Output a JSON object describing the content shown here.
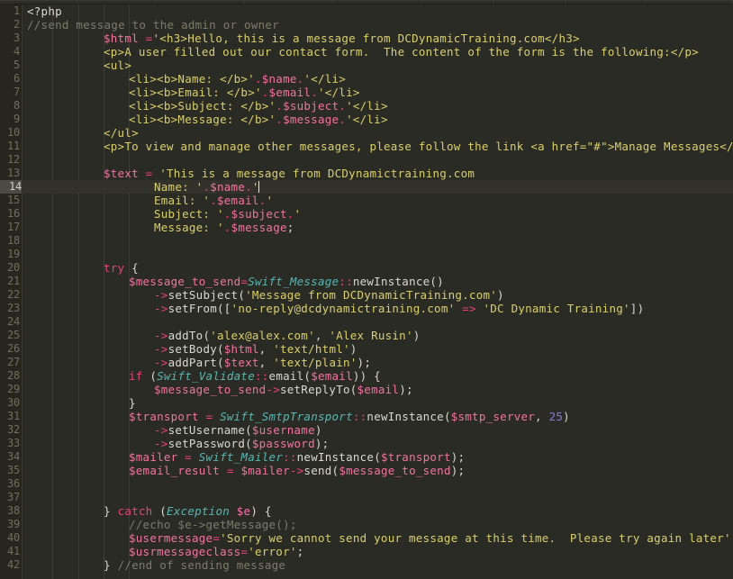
{
  "window": {
    "app": "code-editor",
    "language": "php",
    "background_color": "#2b2b26",
    "gutter_color": "#26261f",
    "active_line_color": "#32322b",
    "active_line_number_color": "#4b4b43"
  },
  "editor": {
    "first_visible_line": 1,
    "last_visible_line": 42,
    "active_line": 14,
    "cursor_line": 14,
    "cursor_column": 37,
    "total_visible_lines": 42,
    "line_height_px": 15,
    "font_size_px": 12.5,
    "indent_guide_columns": [
      4,
      8,
      12,
      16
    ]
  },
  "palette": {
    "plain": "#d9d9d1",
    "comment": "#7a7b6c",
    "string": "#d8d06a",
    "variable": "#f2739f",
    "keyword": "#e8417a",
    "operator": "#e8417a",
    "class_name": "#57b7b0",
    "number": "#8a7dd6",
    "line_number": "#6e6f62"
  },
  "code_lines": [
    {
      "n": 1,
      "indent": 0,
      "tokens": [
        {
          "t": "plain",
          "v": "<?php"
        }
      ]
    },
    {
      "n": 2,
      "indent": 0,
      "tokens": [
        {
          "t": "comment",
          "v": "//send message to the admin or owner"
        }
      ]
    },
    {
      "n": 3,
      "indent": 12,
      "tokens": [
        {
          "t": "var",
          "v": "$html"
        },
        {
          "t": "plain",
          "v": " "
        },
        {
          "t": "op",
          "v": "="
        },
        {
          "t": "str",
          "v": "'<h3>Hello, this is a message from DCDynamicTraining.com</h3>"
        }
      ]
    },
    {
      "n": 4,
      "indent": 12,
      "tokens": [
        {
          "t": "str",
          "v": "<p>A user filled out our contact form.  The content of the form is the following:</p>"
        }
      ]
    },
    {
      "n": 5,
      "indent": 12,
      "tokens": [
        {
          "t": "str",
          "v": "<ul>"
        }
      ]
    },
    {
      "n": 6,
      "indent": 16,
      "tokens": [
        {
          "t": "str",
          "v": "<li><b>Name: </b>'"
        },
        {
          "t": "op",
          "v": "."
        },
        {
          "t": "var",
          "v": "$name"
        },
        {
          "t": "op",
          "v": "."
        },
        {
          "t": "str",
          "v": "'</li>"
        }
      ]
    },
    {
      "n": 7,
      "indent": 16,
      "tokens": [
        {
          "t": "str",
          "v": "<li><b>Email: </b>'"
        },
        {
          "t": "op",
          "v": "."
        },
        {
          "t": "var",
          "v": "$email"
        },
        {
          "t": "op",
          "v": "."
        },
        {
          "t": "str",
          "v": "'</li>"
        }
      ]
    },
    {
      "n": 8,
      "indent": 16,
      "tokens": [
        {
          "t": "str",
          "v": "<li><b>Subject: </b>'"
        },
        {
          "t": "op",
          "v": "."
        },
        {
          "t": "var",
          "v": "$subject"
        },
        {
          "t": "op",
          "v": "."
        },
        {
          "t": "str",
          "v": "'</li>"
        }
      ]
    },
    {
      "n": 9,
      "indent": 16,
      "tokens": [
        {
          "t": "str",
          "v": "<li><b>Message: </b>'"
        },
        {
          "t": "op",
          "v": "."
        },
        {
          "t": "var",
          "v": "$message"
        },
        {
          "t": "op",
          "v": "."
        },
        {
          "t": "str",
          "v": "'</li>"
        }
      ]
    },
    {
      "n": 10,
      "indent": 12,
      "tokens": [
        {
          "t": "str",
          "v": "</ul>"
        }
      ]
    },
    {
      "n": 11,
      "indent": 12,
      "tokens": [
        {
          "t": "str",
          "v": "<p>To view and manage other messages, please follow the link <a href=\"#\">Manage Messages</a></p>'"
        },
        {
          "t": "punc",
          "v": ";"
        }
      ]
    },
    {
      "n": 12,
      "indent": 0,
      "tokens": []
    },
    {
      "n": 13,
      "indent": 12,
      "tokens": [
        {
          "t": "var",
          "v": "$text"
        },
        {
          "t": "plain",
          "v": " "
        },
        {
          "t": "op",
          "v": "="
        },
        {
          "t": "plain",
          "v": " "
        },
        {
          "t": "str",
          "v": "'This is a message from DCDynamictraining.com"
        }
      ]
    },
    {
      "n": 14,
      "indent": 20,
      "tokens": [
        {
          "t": "str",
          "v": "Name: '"
        },
        {
          "t": "op",
          "v": "."
        },
        {
          "t": "var",
          "v": "$name"
        },
        {
          "t": "op",
          "v": "."
        },
        {
          "t": "str",
          "v": "'"
        },
        {
          "t": "caret",
          "v": ""
        }
      ]
    },
    {
      "n": 15,
      "indent": 20,
      "tokens": [
        {
          "t": "str",
          "v": "Email: '"
        },
        {
          "t": "op",
          "v": "."
        },
        {
          "t": "var",
          "v": "$email"
        },
        {
          "t": "op",
          "v": "."
        },
        {
          "t": "str",
          "v": "'"
        }
      ]
    },
    {
      "n": 16,
      "indent": 20,
      "tokens": [
        {
          "t": "str",
          "v": "Subject: '"
        },
        {
          "t": "op",
          "v": "."
        },
        {
          "t": "var",
          "v": "$subject"
        },
        {
          "t": "op",
          "v": "."
        },
        {
          "t": "str",
          "v": "'"
        }
      ]
    },
    {
      "n": 17,
      "indent": 20,
      "tokens": [
        {
          "t": "str",
          "v": "Message: '"
        },
        {
          "t": "op",
          "v": "."
        },
        {
          "t": "var",
          "v": "$message"
        },
        {
          "t": "punc",
          "v": ";"
        }
      ]
    },
    {
      "n": 18,
      "indent": 0,
      "tokens": []
    },
    {
      "n": 19,
      "indent": 0,
      "tokens": []
    },
    {
      "n": 20,
      "indent": 12,
      "tokens": [
        {
          "t": "kw",
          "v": "try"
        },
        {
          "t": "punc",
          "v": " {"
        }
      ]
    },
    {
      "n": 21,
      "indent": 16,
      "tokens": [
        {
          "t": "var",
          "v": "$message_to_send"
        },
        {
          "t": "op",
          "v": "="
        },
        {
          "t": "cls",
          "v": "Swift_Message"
        },
        {
          "t": "op",
          "v": "::"
        },
        {
          "t": "plain",
          "v": "newInstance()"
        }
      ]
    },
    {
      "n": 22,
      "indent": 20,
      "tokens": [
        {
          "t": "op",
          "v": "->"
        },
        {
          "t": "plain",
          "v": "setSubject("
        },
        {
          "t": "str",
          "v": "'Message from DCDynamicTraining.com'"
        },
        {
          "t": "plain",
          "v": ")"
        }
      ]
    },
    {
      "n": 23,
      "indent": 20,
      "tokens": [
        {
          "t": "op",
          "v": "->"
        },
        {
          "t": "plain",
          "v": "setFrom(["
        },
        {
          "t": "str",
          "v": "'no-reply@dcdynamictraining.com'"
        },
        {
          "t": "plain",
          "v": " "
        },
        {
          "t": "op",
          "v": "=>"
        },
        {
          "t": "plain",
          "v": " "
        },
        {
          "t": "str",
          "v": "'DC Dynamic Training'"
        },
        {
          "t": "plain",
          "v": "])"
        }
      ]
    },
    {
      "n": 24,
      "indent": 0,
      "tokens": []
    },
    {
      "n": 25,
      "indent": 20,
      "tokens": [
        {
          "t": "op",
          "v": "->"
        },
        {
          "t": "plain",
          "v": "addTo("
        },
        {
          "t": "str",
          "v": "'alex@alex.com'"
        },
        {
          "t": "plain",
          "v": ", "
        },
        {
          "t": "str",
          "v": "'Alex Rusin'"
        },
        {
          "t": "plain",
          "v": ")"
        }
      ]
    },
    {
      "n": 26,
      "indent": 20,
      "tokens": [
        {
          "t": "op",
          "v": "->"
        },
        {
          "t": "plain",
          "v": "setBody("
        },
        {
          "t": "var",
          "v": "$html"
        },
        {
          "t": "plain",
          "v": ", "
        },
        {
          "t": "str",
          "v": "'text/html'"
        },
        {
          "t": "plain",
          "v": ")"
        }
      ]
    },
    {
      "n": 27,
      "indent": 20,
      "tokens": [
        {
          "t": "op",
          "v": "->"
        },
        {
          "t": "plain",
          "v": "addPart("
        },
        {
          "t": "var",
          "v": "$text"
        },
        {
          "t": "plain",
          "v": ", "
        },
        {
          "t": "str",
          "v": "'text/plain'"
        },
        {
          "t": "plain",
          "v": ");"
        }
      ]
    },
    {
      "n": 28,
      "indent": 16,
      "tokens": [
        {
          "t": "kw",
          "v": "if"
        },
        {
          "t": "plain",
          "v": " ("
        },
        {
          "t": "cls",
          "v": "Swift_Validate"
        },
        {
          "t": "op",
          "v": "::"
        },
        {
          "t": "plain",
          "v": "email("
        },
        {
          "t": "var",
          "v": "$email"
        },
        {
          "t": "plain",
          "v": ")) {"
        }
      ]
    },
    {
      "n": 29,
      "indent": 20,
      "tokens": [
        {
          "t": "var",
          "v": "$message_to_send"
        },
        {
          "t": "op",
          "v": "->"
        },
        {
          "t": "plain",
          "v": "setReplyTo("
        },
        {
          "t": "var",
          "v": "$email"
        },
        {
          "t": "plain",
          "v": ");"
        }
      ]
    },
    {
      "n": 30,
      "indent": 16,
      "tokens": [
        {
          "t": "punc",
          "v": "}"
        }
      ]
    },
    {
      "n": 31,
      "indent": 16,
      "tokens": [
        {
          "t": "var",
          "v": "$transport"
        },
        {
          "t": "plain",
          "v": " "
        },
        {
          "t": "op",
          "v": "="
        },
        {
          "t": "plain",
          "v": " "
        },
        {
          "t": "cls",
          "v": "Swift_SmtpTransport"
        },
        {
          "t": "op",
          "v": "::"
        },
        {
          "t": "plain",
          "v": "newInstance("
        },
        {
          "t": "var",
          "v": "$smtp_server"
        },
        {
          "t": "plain",
          "v": ", "
        },
        {
          "t": "num",
          "v": "25"
        },
        {
          "t": "plain",
          "v": ")"
        }
      ]
    },
    {
      "n": 32,
      "indent": 20,
      "tokens": [
        {
          "t": "op",
          "v": "->"
        },
        {
          "t": "plain",
          "v": "setUsername("
        },
        {
          "t": "var",
          "v": "$username"
        },
        {
          "t": "plain",
          "v": ")"
        }
      ]
    },
    {
      "n": 33,
      "indent": 20,
      "tokens": [
        {
          "t": "op",
          "v": "->"
        },
        {
          "t": "plain",
          "v": "setPassword("
        },
        {
          "t": "var",
          "v": "$password"
        },
        {
          "t": "plain",
          "v": ");"
        }
      ]
    },
    {
      "n": 34,
      "indent": 16,
      "tokens": [
        {
          "t": "var",
          "v": "$mailer"
        },
        {
          "t": "plain",
          "v": " "
        },
        {
          "t": "op",
          "v": "="
        },
        {
          "t": "plain",
          "v": " "
        },
        {
          "t": "cls",
          "v": "Swift_Mailer"
        },
        {
          "t": "op",
          "v": "::"
        },
        {
          "t": "plain",
          "v": "newInstance("
        },
        {
          "t": "var",
          "v": "$transport"
        },
        {
          "t": "plain",
          "v": ");"
        }
      ]
    },
    {
      "n": 35,
      "indent": 16,
      "tokens": [
        {
          "t": "var",
          "v": "$email_result"
        },
        {
          "t": "plain",
          "v": " "
        },
        {
          "t": "op",
          "v": "="
        },
        {
          "t": "plain",
          "v": " "
        },
        {
          "t": "var",
          "v": "$mailer"
        },
        {
          "t": "op",
          "v": "->"
        },
        {
          "t": "plain",
          "v": "send("
        },
        {
          "t": "var",
          "v": "$message_to_send"
        },
        {
          "t": "plain",
          "v": ");"
        }
      ]
    },
    {
      "n": 36,
      "indent": 0,
      "tokens": []
    },
    {
      "n": 37,
      "indent": 0,
      "tokens": []
    },
    {
      "n": 38,
      "indent": 12,
      "tokens": [
        {
          "t": "punc",
          "v": "} "
        },
        {
          "t": "kw",
          "v": "catch"
        },
        {
          "t": "plain",
          "v": " ("
        },
        {
          "t": "cls",
          "v": "Exception"
        },
        {
          "t": "plain",
          "v": " "
        },
        {
          "t": "var",
          "v": "$e"
        },
        {
          "t": "plain",
          "v": ") {"
        }
      ]
    },
    {
      "n": 39,
      "indent": 16,
      "tokens": [
        {
          "t": "comment",
          "v": "//echo $e->getMessage();"
        }
      ]
    },
    {
      "n": 40,
      "indent": 16,
      "tokens": [
        {
          "t": "var",
          "v": "$usermessage"
        },
        {
          "t": "op",
          "v": "="
        },
        {
          "t": "str",
          "v": "'Sorry we cannot send your message at this time.  Please try again later'"
        },
        {
          "t": "punc",
          "v": ";"
        }
      ]
    },
    {
      "n": 41,
      "indent": 16,
      "tokens": [
        {
          "t": "var",
          "v": "$usrmessageclass"
        },
        {
          "t": "op",
          "v": "="
        },
        {
          "t": "str",
          "v": "'error'"
        },
        {
          "t": "punc",
          "v": ";"
        }
      ]
    },
    {
      "n": 42,
      "indent": 12,
      "tokens": [
        {
          "t": "punc",
          "v": "} "
        },
        {
          "t": "comment",
          "v": "//end of sending message"
        }
      ]
    }
  ]
}
